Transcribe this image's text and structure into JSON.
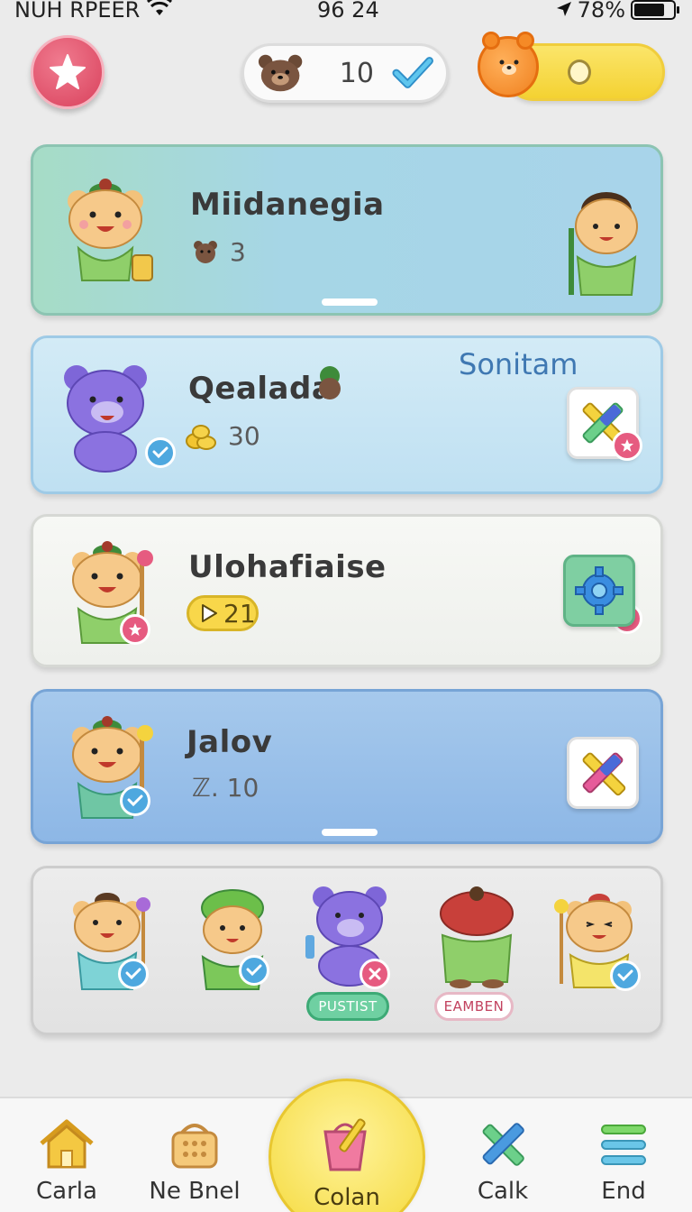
{
  "status_bar": {
    "carrier": "NUH RPEER",
    "time": "96 24",
    "battery": "78%",
    "battery_level": 0.78
  },
  "header": {
    "counter_value": "10"
  },
  "cards": [
    {
      "title": "Miidanegia",
      "meta": "3"
    },
    {
      "title": "Qealada",
      "meta": "30",
      "label": "Sonitam"
    },
    {
      "title": "Ulohafiaise",
      "meta": "21"
    },
    {
      "title": "Jalov",
      "meta": "ℤ. 10"
    }
  ],
  "roster": {
    "tags": [
      "PUSTIST",
      "EAMBEN"
    ]
  },
  "bottom_nav": {
    "items": [
      "Carla",
      "Ne Bnel",
      "Colan",
      "Calk",
      "End"
    ]
  }
}
